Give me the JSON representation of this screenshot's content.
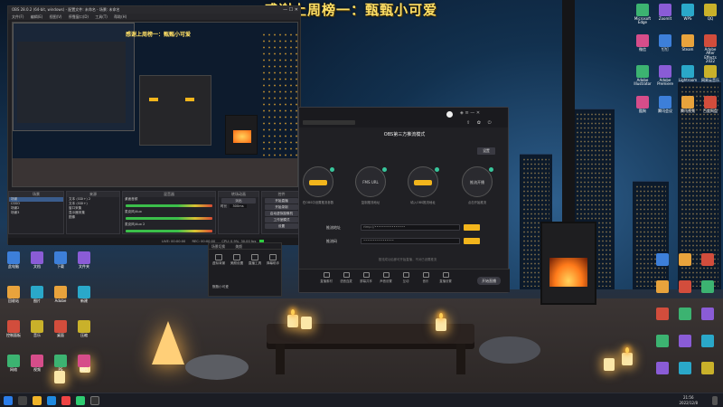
{
  "overlay": {
    "title": "感谢上周榜一：甄甄小可爱"
  },
  "obs": {
    "title": "OBS 28.0.2 (64-bit, windows) - 配置文件: 未命名 - 场景: 未命名",
    "menu": [
      "文件(F)",
      "编辑(E)",
      "视图(V)",
      "停靠窗口(D)",
      "工具(T)",
      "帮助(H)"
    ],
    "preview_title": "感谢上周榜一：甄甄小可爱",
    "docks": {
      "scenes": {
        "header": "场景",
        "items": [
          "场景",
          "CSSO",
          "场景2",
          "场景3"
        ]
      },
      "sources": {
        "header": "来源",
        "items": [
          "文本 (GDI+) 2",
          "文本 (GDI+)",
          "窗口采集",
          "显示器采集",
          "图像"
        ]
      },
      "mixer": {
        "header": "混音器",
        "tracks": [
          "桌面音频",
          "麦克风/Aux",
          "麦克风/Aux 2"
        ]
      },
      "transitions": {
        "header": "转场动画",
        "value": "淡出",
        "duration_label": "时长",
        "duration": "300ms"
      },
      "controls": {
        "header": "控件",
        "buttons": [
          "开始直播",
          "开始录制",
          "启动虚拟摄像机",
          "工作室模式",
          "设置",
          "退出"
        ]
      }
    },
    "status": {
      "live": "LIVE: 00:00:00",
      "rec": "REC: 00:00:00",
      "cpu": "CPU: 0.9%, 30.00 fps"
    }
  },
  "side_panel": {
    "tabs": [
      "场景切换",
      "美颜"
    ],
    "items": [
      "虚拟背景",
      "美颜设置",
      "直播工具",
      "弹幕助手"
    ],
    "user": "甄甄小可爱"
  },
  "plugin": {
    "heading": "OBS第三方推流模式",
    "header_btn": "设置",
    "steps": [
      {
        "label": "步骤1",
        "caption": "在OBS中设置推流参数"
      },
      {
        "label": "FMS URL",
        "caption": "复制推流地址"
      },
      {
        "label": "复制",
        "caption": "填入OBS推流地址"
      },
      {
        "label": "推流开播",
        "caption": "点击开始推流"
      }
    ],
    "fields": [
      {
        "label": "推流地址",
        "value": "rtmp://••••••••••••••••"
      },
      {
        "label": "推流码",
        "value": "••••••••••••••••"
      }
    ],
    "note": "推流成功后即可开始直播，不对已设置推流",
    "bottom": [
      "直播素材",
      "语音连麦",
      "屏幕共享",
      "声音设置",
      "互动",
      "音乐",
      "直播设置"
    ],
    "start_btn": "开始直播"
  },
  "desktop_icons_left": [
    "此电脑",
    "回收站",
    "控制面板",
    "网络",
    "文档",
    "图片",
    "音乐",
    "视频",
    "下载",
    "Adobe",
    "桌面",
    "PS",
    "文件夹",
    "新建",
    "压缩",
    "项目"
  ],
  "desktop_icons_right": [
    "Microsoft Edge",
    "ZoomIt",
    "WPS",
    "QQ",
    "微信",
    "钉钉",
    "Steam",
    "Adobe After Effects 2022",
    "Adobe Illustrator",
    "Adobe Premiere",
    "Lightroom",
    "网易云音乐",
    "酷狗",
    "腾讯会议",
    "腾讯视频",
    "百度网盘"
  ],
  "taskbar": {
    "time": "21:56",
    "date": "2022/12/8"
  }
}
